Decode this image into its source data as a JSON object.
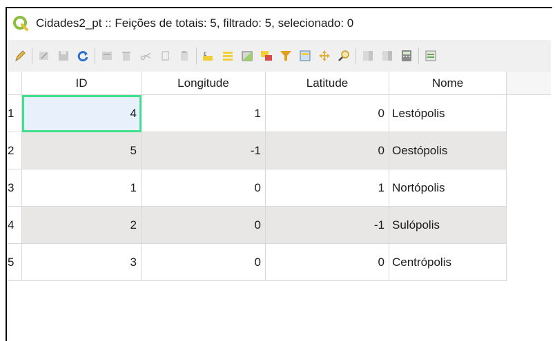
{
  "window": {
    "title": "Cidades2_pt :: Feições de totais: 5, filtrado: 5, selecionado: 0"
  },
  "toolbar": {
    "icons": [
      "pencil-icon",
      "multi-edit-icon",
      "save-icon",
      "reload-icon",
      "add-feature-icon",
      "delete-icon",
      "cut-icon",
      "copy-icon",
      "paste-icon",
      "expression-select-icon",
      "select-all-icon",
      "invert-selection-icon",
      "deselect-icon",
      "move-selection-top-icon",
      "filter-icon",
      "pan-to-selected-icon",
      "zoom-to-selected-icon",
      "new-field-icon",
      "delete-field-icon",
      "field-calculator-icon",
      "conditional-format-icon"
    ]
  },
  "table": {
    "headers": [
      "ID",
      "Longitude",
      "Latitude",
      "Nome"
    ],
    "rows": [
      {
        "num": "1",
        "id": "4",
        "lon": "1",
        "lat": "0",
        "nome": "Lestópolis"
      },
      {
        "num": "2",
        "id": "5",
        "lon": "-1",
        "lat": "0",
        "nome": "Oestópolis"
      },
      {
        "num": "3",
        "id": "1",
        "lon": "0",
        "lat": "1",
        "nome": "Nortópolis"
      },
      {
        "num": "4",
        "id": "2",
        "lon": "0",
        "lat": "-1",
        "nome": "Sulópolis"
      },
      {
        "num": "5",
        "id": "3",
        "lon": "0",
        "lat": "0",
        "nome": "Centrópolis"
      }
    ]
  },
  "colors": {
    "selection_outline": "#3ee08b",
    "alt_row": "#e9e7e5",
    "qgis_green": "#8bbf3f"
  }
}
